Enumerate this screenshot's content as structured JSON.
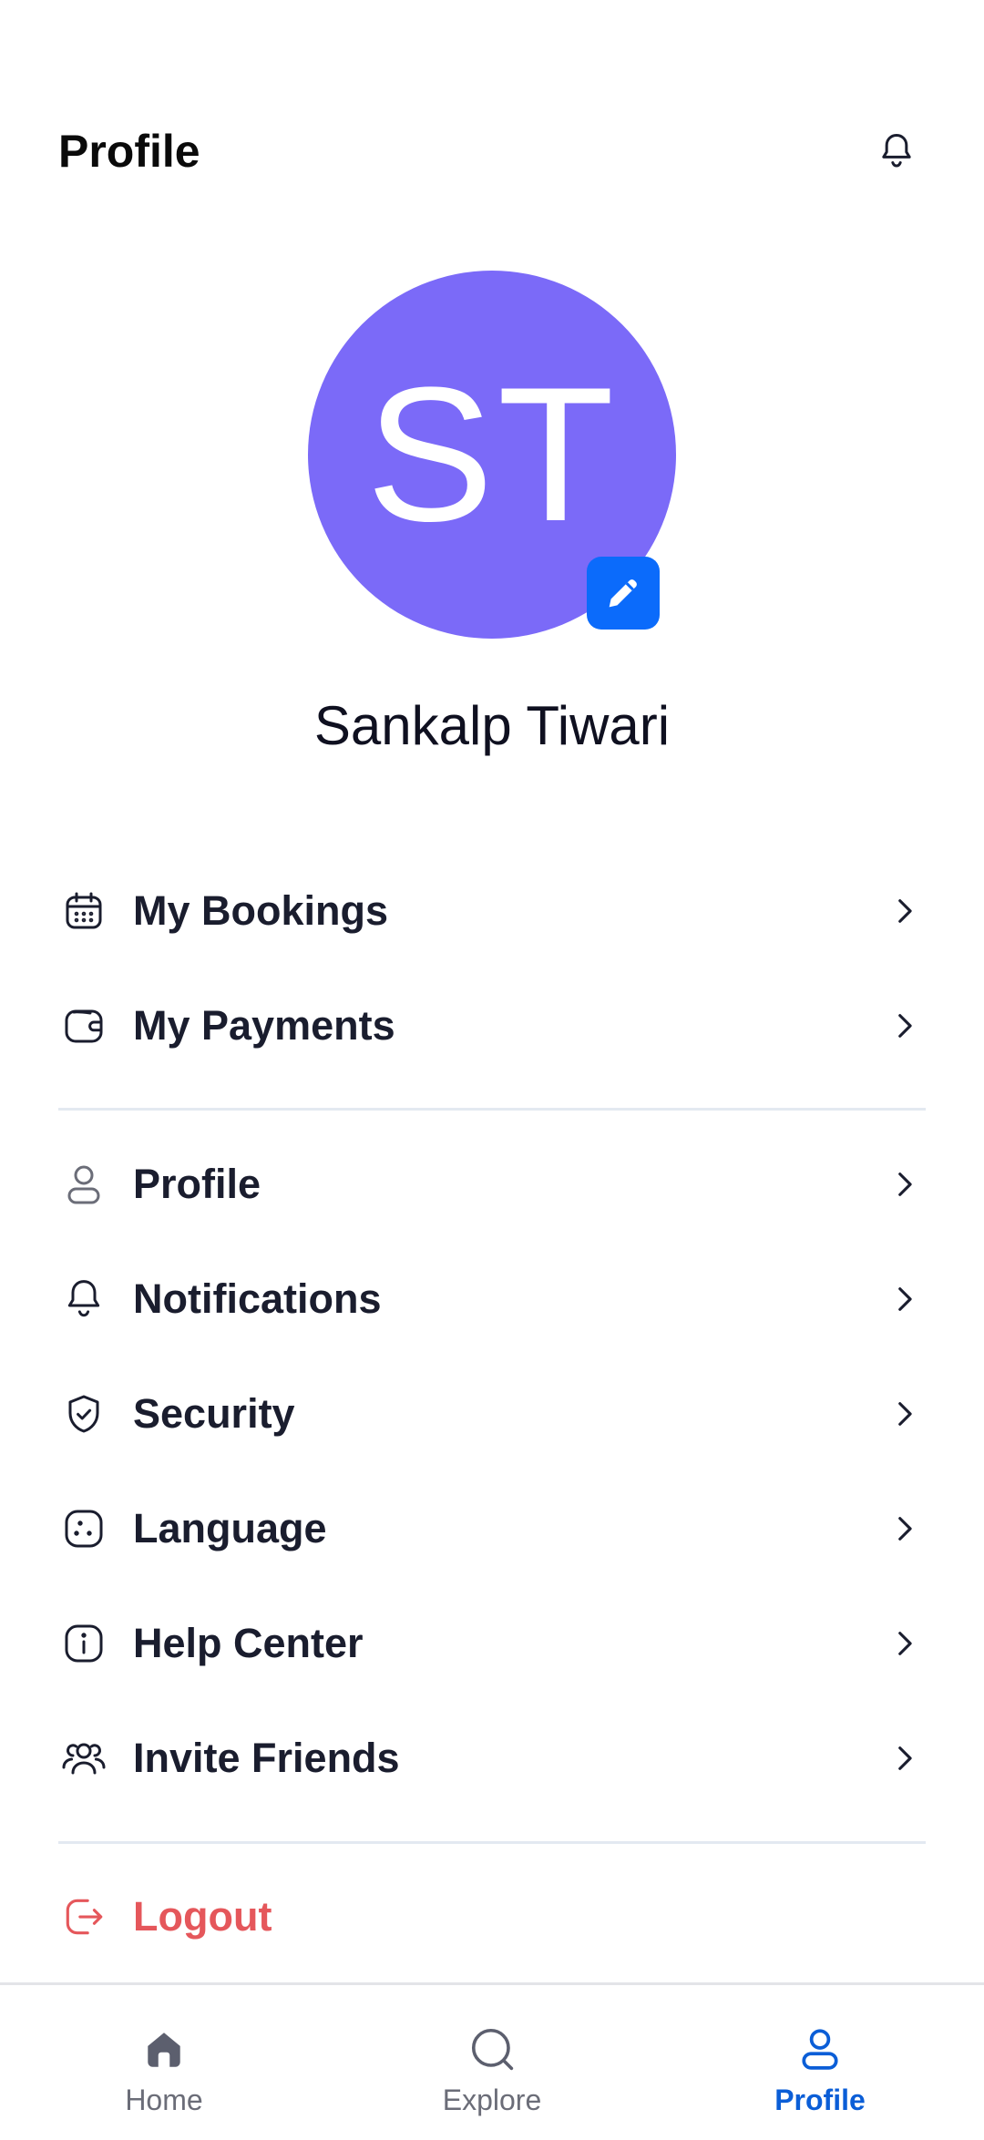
{
  "header": {
    "title": "Profile"
  },
  "profile": {
    "initials": "ST",
    "name": "Sankalp Tiwari",
    "avatar_color": "#7b6af8",
    "edit_color": "#0b6bfb"
  },
  "menu": {
    "group1": [
      {
        "label": "My Bookings",
        "icon": "calendar-icon"
      },
      {
        "label": "My Payments",
        "icon": "wallet-icon"
      }
    ],
    "group2": [
      {
        "label": "Profile",
        "icon": "user-icon"
      },
      {
        "label": "Notifications",
        "icon": "bell-icon"
      },
      {
        "label": "Security",
        "icon": "shield-check-icon"
      },
      {
        "label": "Language",
        "icon": "language-icon"
      },
      {
        "label": "Help Center",
        "icon": "info-icon"
      },
      {
        "label": "Invite Friends",
        "icon": "users-icon"
      }
    ],
    "logout": {
      "label": "Logout",
      "icon": "logout-icon",
      "color": "#e5575b"
    }
  },
  "nav": {
    "items": [
      {
        "label": "Home",
        "icon": "home-icon"
      },
      {
        "label": "Explore",
        "icon": "search-icon"
      },
      {
        "label": "Profile",
        "icon": "user-icon",
        "active": true
      }
    ],
    "active_color": "#0b5ed7"
  }
}
